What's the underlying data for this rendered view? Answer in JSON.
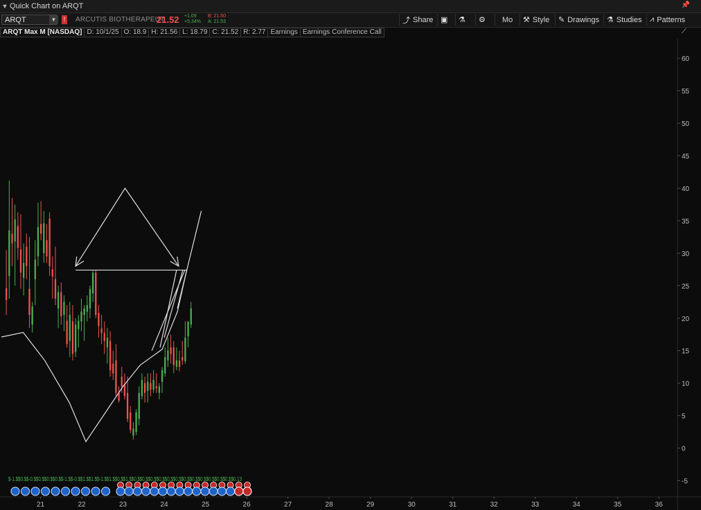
{
  "window": {
    "title": "Quick Chart on ARQT"
  },
  "toolbar": {
    "symbol": "ARQT",
    "company": "ARCUTIS BIOTHERAPEUT",
    "last_price": "21.52",
    "change_abs": "+1.09",
    "change_pct": "+5.34%",
    "bid": "B: 21.50",
    "ask": "A: 21.53",
    "buttons": {
      "share": "Share",
      "more": "Mo",
      "style": "Style",
      "drawings": "Drawings",
      "studies": "Studies",
      "patterns": "Patterns"
    }
  },
  "infobar": {
    "symbol_label": "ARQT Max M [NASDAQ]",
    "date": "D: 10/1/25",
    "open": "O: 18.9",
    "high": "H: 21.56",
    "low": "L: 18.79",
    "close": "C: 21.52",
    "range": "R: 2.77",
    "earnings": "Earnings",
    "conference_call": "Earnings Conference Call"
  },
  "colors": {
    "up": "#4caf50",
    "down": "#ef5350",
    "background": "#0c0c0c",
    "drawing": "#e0e0e0"
  },
  "chart_data": {
    "type": "candlestick",
    "y_ticks": [
      -5,
      0,
      5,
      10,
      15,
      20,
      25,
      30,
      35,
      40,
      45,
      50,
      55,
      60
    ],
    "x_ticks": [
      "21",
      "22",
      "23",
      "24",
      "25",
      "26",
      "27",
      "28",
      "29",
      "30",
      "31",
      "32",
      "33",
      "34",
      "35",
      "36"
    ],
    "ylim": [
      -7.5,
      63
    ],
    "xlim": [
      20.05,
      36.45
    ],
    "candles": [
      {
        "x": 20.17,
        "o": 24.6,
        "h": 30.5,
        "l": 20.5,
        "c": 22.8
      },
      {
        "x": 20.24,
        "o": 26.5,
        "h": 41.2,
        "l": 23.0,
        "c": 33.5
      },
      {
        "x": 20.31,
        "o": 33.0,
        "h": 38.5,
        "l": 28.0,
        "c": 31.5
      },
      {
        "x": 20.38,
        "o": 31.8,
        "h": 37.5,
        "l": 25.0,
        "c": 35.2
      },
      {
        "x": 20.45,
        "o": 34.2,
        "h": 36.3,
        "l": 29.0,
        "c": 30.8
      },
      {
        "x": 20.52,
        "o": 30.6,
        "h": 36.0,
        "l": 24.5,
        "c": 27.0
      },
      {
        "x": 20.59,
        "o": 26.2,
        "h": 31.5,
        "l": 23.5,
        "c": 28.5
      },
      {
        "x": 20.66,
        "o": 31.0,
        "h": 33.0,
        "l": 26.0,
        "c": 28.0
      },
      {
        "x": 20.73,
        "o": 24.5,
        "h": 32.5,
        "l": 18.5,
        "c": 20.5
      },
      {
        "x": 20.8,
        "o": 19.0,
        "h": 22.5,
        "l": 17.8,
        "c": 21.8
      },
      {
        "x": 20.87,
        "o": 26.0,
        "h": 32.0,
        "l": 22.0,
        "c": 29.0
      },
      {
        "x": 20.94,
        "o": 29.5,
        "h": 37.8,
        "l": 28.0,
        "c": 34.0
      },
      {
        "x": 21.01,
        "o": 34.5,
        "h": 38.0,
        "l": 32.0,
        "c": 33.0
      },
      {
        "x": 21.08,
        "o": 30.0,
        "h": 36.5,
        "l": 28.5,
        "c": 34.6
      },
      {
        "x": 21.15,
        "o": 32.0,
        "h": 34.5,
        "l": 28.5,
        "c": 29.5
      },
      {
        "x": 21.22,
        "o": 35.3,
        "h": 36.3,
        "l": 26.5,
        "c": 28.0
      },
      {
        "x": 21.29,
        "o": 27.5,
        "h": 29.5,
        "l": 23.0,
        "c": 26.4
      },
      {
        "x": 21.36,
        "o": 26.0,
        "h": 31.0,
        "l": 22.0,
        "c": 23.0
      },
      {
        "x": 21.43,
        "o": 21.5,
        "h": 25.0,
        "l": 18.5,
        "c": 24.0
      },
      {
        "x": 21.5,
        "o": 24.0,
        "h": 25.5,
        "l": 19.0,
        "c": 20.3
      },
      {
        "x": 21.57,
        "o": 20.5,
        "h": 23.5,
        "l": 18.0,
        "c": 22.5
      },
      {
        "x": 21.64,
        "o": 19.6,
        "h": 22.0,
        "l": 15.5,
        "c": 16.0
      },
      {
        "x": 21.71,
        "o": 16.5,
        "h": 22.5,
        "l": 14.0,
        "c": 20.5
      },
      {
        "x": 21.78,
        "o": 19.5,
        "h": 22.0,
        "l": 13.5,
        "c": 14.5
      },
      {
        "x": 21.85,
        "o": 14.8,
        "h": 20.0,
        "l": 14.0,
        "c": 19.0
      },
      {
        "x": 21.92,
        "o": 18.3,
        "h": 20.5,
        "l": 15.5,
        "c": 19.6
      },
      {
        "x": 21.99,
        "o": 19.5,
        "h": 23.0,
        "l": 18.0,
        "c": 21.0
      },
      {
        "x": 22.06,
        "o": 20.5,
        "h": 22.0,
        "l": 16.5,
        "c": 21.5
      },
      {
        "x": 22.13,
        "o": 21.0,
        "h": 23.5,
        "l": 19.5,
        "c": 22.0
      },
      {
        "x": 22.2,
        "o": 21.5,
        "h": 25.0,
        "l": 20.0,
        "c": 24.5
      },
      {
        "x": 22.27,
        "o": 23.8,
        "h": 27.3,
        "l": 22.5,
        "c": 27.0
      },
      {
        "x": 22.34,
        "o": 27.0,
        "h": 27.4,
        "l": 20.0,
        "c": 20.5
      },
      {
        "x": 22.41,
        "o": 20.8,
        "h": 22.0,
        "l": 17.0,
        "c": 18.8
      },
      {
        "x": 22.48,
        "o": 18.4,
        "h": 20.5,
        "l": 16.0,
        "c": 17.7
      },
      {
        "x": 22.55,
        "o": 17.7,
        "h": 19.5,
        "l": 14.5,
        "c": 16.5
      },
      {
        "x": 22.62,
        "o": 15.5,
        "h": 18.5,
        "l": 13.0,
        "c": 17.0
      },
      {
        "x": 22.69,
        "o": 16.5,
        "h": 18.0,
        "l": 11.0,
        "c": 12.0
      },
      {
        "x": 22.76,
        "o": 13.0,
        "h": 15.0,
        "l": 10.5,
        "c": 11.5
      },
      {
        "x": 22.83,
        "o": 13.5,
        "h": 16.0,
        "l": 8.0,
        "c": 8.5
      },
      {
        "x": 22.9,
        "o": 8.5,
        "h": 9.5,
        "l": 7.0,
        "c": 7.3
      },
      {
        "x": 22.97,
        "o": 11.0,
        "h": 12.5,
        "l": 8.5,
        "c": 9.5
      },
      {
        "x": 23.04,
        "o": 9.8,
        "h": 11.5,
        "l": 7.5,
        "c": 8.0
      },
      {
        "x": 23.11,
        "o": 8.5,
        "h": 11.0,
        "l": 4.0,
        "c": 4.5
      },
      {
        "x": 23.18,
        "o": 5.5,
        "h": 6.5,
        "l": 2.3,
        "c": 2.8
      },
      {
        "x": 23.25,
        "o": 1.9,
        "h": 4.0,
        "l": 1.3,
        "c": 3.0
      },
      {
        "x": 23.32,
        "o": 2.5,
        "h": 6.0,
        "l": 2.0,
        "c": 5.5
      },
      {
        "x": 23.39,
        "o": 4.5,
        "h": 9.5,
        "l": 3.5,
        "c": 8.5
      },
      {
        "x": 23.46,
        "o": 8.0,
        "h": 11.5,
        "l": 7.5,
        "c": 10.5
      },
      {
        "x": 23.53,
        "o": 10.0,
        "h": 11.0,
        "l": 7.0,
        "c": 8.5
      },
      {
        "x": 23.6,
        "o": 8.8,
        "h": 11.5,
        "l": 7.0,
        "c": 10.2
      },
      {
        "x": 23.67,
        "o": 10.0,
        "h": 11.5,
        "l": 8.0,
        "c": 9.0
      },
      {
        "x": 23.74,
        "o": 9.0,
        "h": 12.0,
        "l": 8.5,
        "c": 10.5
      },
      {
        "x": 23.81,
        "o": 9.5,
        "h": 11.5,
        "l": 8.5,
        "c": 9.2
      },
      {
        "x": 23.88,
        "o": 8.5,
        "h": 10.0,
        "l": 7.5,
        "c": 9.5
      },
      {
        "x": 23.95,
        "o": 10.2,
        "h": 12.5,
        "l": 8.5,
        "c": 12.0
      },
      {
        "x": 24.02,
        "o": 11.5,
        "h": 15.5,
        "l": 11.0,
        "c": 14.0
      },
      {
        "x": 24.09,
        "o": 13.5,
        "h": 17.0,
        "l": 12.5,
        "c": 15.0
      },
      {
        "x": 24.16,
        "o": 15.5,
        "h": 17.5,
        "l": 13.0,
        "c": 14.5
      },
      {
        "x": 24.23,
        "o": 15.5,
        "h": 16.5,
        "l": 11.5,
        "c": 12.8
      },
      {
        "x": 24.3,
        "o": 12.5,
        "h": 15.5,
        "l": 12.0,
        "c": 13.5
      },
      {
        "x": 24.37,
        "o": 13.5,
        "h": 15.0,
        "l": 11.8,
        "c": 12.5
      },
      {
        "x": 24.44,
        "o": 14.0,
        "h": 16.5,
        "l": 12.8,
        "c": 13.5
      },
      {
        "x": 24.51,
        "o": 13.4,
        "h": 19.5,
        "l": 13.0,
        "c": 17.0
      },
      {
        "x": 24.58,
        "o": 17.2,
        "h": 19.0,
        "l": 15.5,
        "c": 19.5
      },
      {
        "x": 24.65,
        "o": 19.0,
        "h": 22.5,
        "l": 18.5,
        "c": 21.5
      }
    ],
    "overlays": [
      [
        [
          20.05,
          17.1
        ],
        [
          20.58,
          17.8
        ],
        [
          21.1,
          13.5
        ],
        [
          21.7,
          7.0
        ],
        [
          22.1,
          1.0
        ],
        [
          23.0,
          9.5
        ],
        [
          23.42,
          12.8
        ],
        [
          23.95,
          15.2
        ],
        [
          24.32,
          21.0
        ],
        [
          24.55,
          27.5
        ]
      ],
      [
        [
          21.85,
          27.4
        ],
        [
          24.55,
          27.4
        ]
      ],
      [
        [
          21.85,
          28.0
        ],
        [
          23.05,
          40.0
        ],
        [
          24.35,
          28.0
        ]
      ],
      [
        [
          24.32,
          21.5
        ],
        [
          24.9,
          36.5
        ]
      ],
      [
        [
          24.0,
          17.0
        ],
        [
          24.45,
          27.4
        ]
      ],
      [
        [
          23.9,
          15.5
        ],
        [
          24.3,
          27.4
        ]
      ],
      [
        [
          23.7,
          15.0
        ],
        [
          24.5,
          27.4
        ]
      ]
    ],
    "arrows": [
      {
        "at": [
          21.85,
          28.0
        ],
        "from": [
          23.05,
          40.0
        ]
      },
      {
        "at": [
          24.35,
          28.0
        ],
        "from": [
          23.05,
          40.0
        ]
      }
    ],
    "event_labels": {
      "green_row": "$-1.$$0.$$-0.$$0.$$0.$$0.$$-1.$$-0.$$1.$$1.$$-1.$$1.$$0.$$1.$$0.$$0.$$0.$$0.$$0.$$0.$$0.$$0.$$0.$$0.$$0.$$0.$$0.13",
      "red_row": "$-1.$$1.$$0.$$1.$$0.$$0.$$0.$$0.$$0.$$0.$$0.$$0.$$0.$$0.$$0.$$0.$$0.$$0.13"
    }
  }
}
